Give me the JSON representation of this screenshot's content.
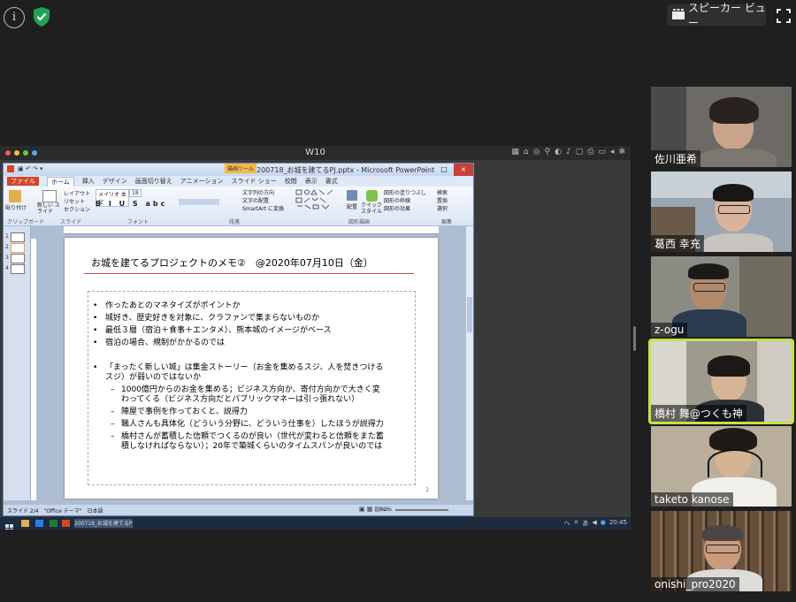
{
  "topbar": {
    "info_glyph": "i",
    "speaker_view_label": "スピーカー ビュー"
  },
  "remote": {
    "title": "W10",
    "powerpoint": {
      "window_title": "200718_お城を建てるPJ.pptx - Microsoft PowerPoint",
      "tool_tab": "描画ツール",
      "window_buttons": [
        "–",
        "□",
        "×"
      ],
      "tabs": [
        "ファイル",
        "ホーム",
        "挿入",
        "デザイン",
        "画面切り替え",
        "アニメーション",
        "スライド ショー",
        "校閲",
        "表示",
        "書式"
      ],
      "ribbon": {
        "paste": "貼り付け",
        "new_slide": "新しい スライド",
        "layout": "レイアウト",
        "reset": "リセット",
        "section": "セクション",
        "font_name": "メイリオ 本文",
        "font_size": "18",
        "text_direction": "文字列の方向",
        "align_text": "文字の配置",
        "smartart": "SmartArt に変換",
        "arrange": "配置",
        "quick_styles": "クイック スタイル",
        "shape_fill": "図形の塗りつぶし",
        "shape_outline": "図形の枠線",
        "shape_effects": "図形の効果",
        "find": "検索",
        "replace": "置換",
        "select": "選択",
        "groups": [
          "クリップボード",
          "スライド",
          "フォント",
          "段落",
          "図形描画",
          "編集"
        ]
      },
      "thumbs": [
        "1",
        "2",
        "3",
        "4"
      ],
      "slide": {
        "title": "お城を建てるプロジェクトのメモ②　@2020年07月10日（金）",
        "bullets": [
          "作ったあとのマネタイズがポイントか",
          "城好き、歴史好きを対象に、クラファンで集まらないものか",
          "最低３層（宿泊＋食事＋エンタメ）、熊本城のイメージがベース",
          "宿泊の場合、規制がかかるのでは"
        ],
        "bullet5_line1": "「まったく新しい城」は集金ストーリー（お金を集めるスジ、人を焚きつける",
        "bullet5_line2": "スジ）が弱いのではないか",
        "subs": [
          [
            "1000億円からのお金を集める；ビジネス方向か、寄付方向かで大きく変",
            "わってくる（ビジネス方向だとパブリックマネーは引っ張れない）"
          ],
          [
            "陣屋で事例を作っておくと、説得力",
            ""
          ],
          [
            "職人さんも具体化（どういう分野に、どういう仕事を）したほうが説得力",
            ""
          ],
          [
            "橋村さんが蓄積した信頼でつくるのが良い（世代が変わると信頼をまた蓄",
            "積しなければならない）；20年で築城くらいのタイムスパンが良いのでは"
          ]
        ],
        "bullet_glyph": "•",
        "sub_glyph": "–",
        "slide_number": "2"
      },
      "status": {
        "left": "スライド 2/4　\"Office テーマ\"　日本語",
        "zoom": "82%"
      }
    },
    "taskbar": {
      "item": "200718_お城を建てるPJ",
      "tray": [
        "へ",
        "あ",
        "20:45"
      ]
    }
  },
  "participants": [
    {
      "name": "佐川亜希",
      "bg": "#6d6a66",
      "skin": "#c9a48a",
      "shirt": "#7c776f",
      "hair": "#2a2220"
    },
    {
      "name": "葛西 幸充",
      "bg": "#9aa6b1",
      "skin": "#d9b39a",
      "shirt": "#c8c4be",
      "hair": "#1a1614"
    },
    {
      "name": "z-ogu",
      "bg": "#8b8b84",
      "skin": "#b18a6e",
      "shirt": "#2c3a4e",
      "hair": "#1c1a18"
    },
    {
      "name": "橋村 舞@つくも神",
      "bg": "#9e9a8e",
      "skin": "#d8b497",
      "shirt": "#2c3138",
      "hair": "#1d1816"
    },
    {
      "name": "taketo kanose",
      "bg": "#b9ad9b",
      "skin": "#d6b393",
      "shirt": "#f0efe9",
      "hair": "#201a16"
    },
    {
      "name": "onishi_pro2020",
      "bg": "#5a4634",
      "skin": "#c89c7c",
      "shirt": "#dcdcd8",
      "hair": "#4a4542"
    }
  ]
}
